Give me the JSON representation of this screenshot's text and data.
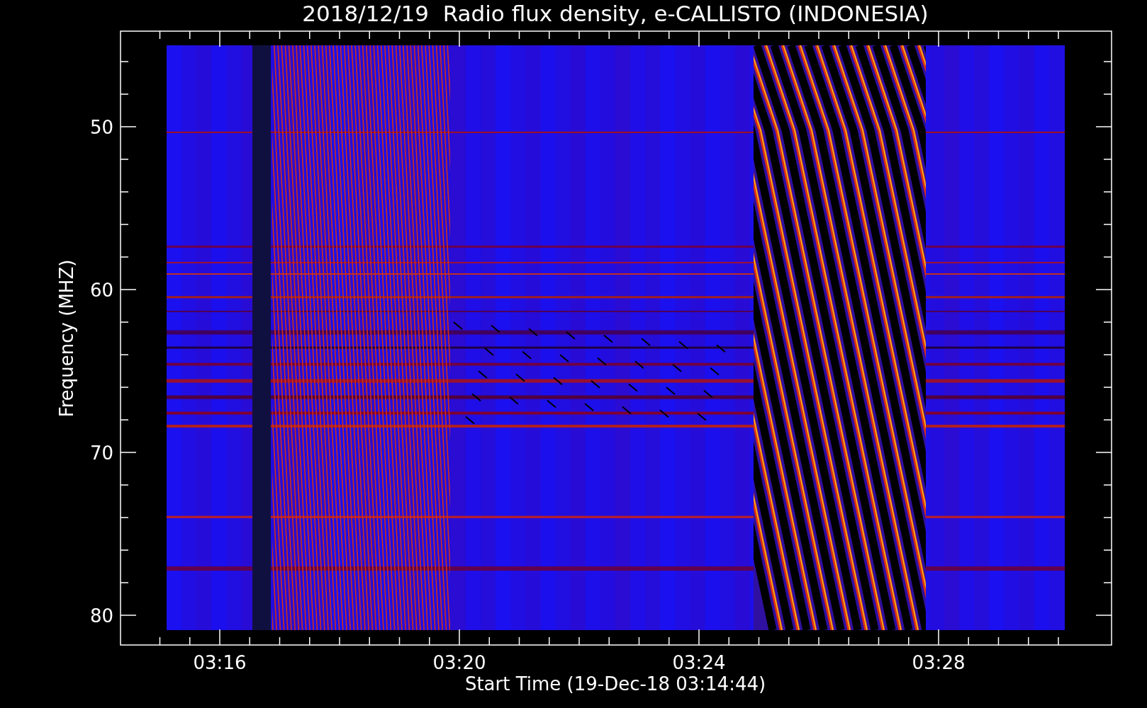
{
  "title": "2018/12/19  Radio flux density, e-CALLISTO (INDONESIA)",
  "ylabel": "Frequency (MHZ)",
  "xlabel": "Start Time (19-Dec-18 03:14:44)",
  "yticks": [
    "50",
    "60",
    "70",
    "80"
  ],
  "xticks": [
    "03:16",
    "03:20",
    "03:24",
    "03:28"
  ]
}
